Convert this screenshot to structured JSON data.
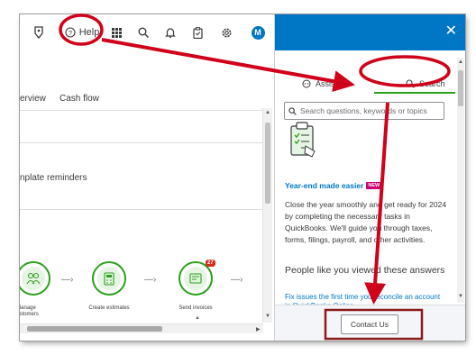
{
  "topbar": {
    "help_label": "Help",
    "avatar_initial": "M",
    "icons": [
      "tag-icon",
      "help-icon",
      "apps-grid-icon",
      "search-icon",
      "bell-icon",
      "clipboard-icon",
      "gear-icon"
    ]
  },
  "tabs": [
    {
      "label": "erview"
    },
    {
      "label": "Cash flow"
    }
  ],
  "reminders": {
    "text": "nplate reminders"
  },
  "flow": {
    "steps": [
      {
        "label": "Manage customers",
        "icon": "customers-icon"
      },
      {
        "label": "Create estimates",
        "icon": "calculator-icon"
      },
      {
        "label": "Send invoices",
        "icon": "invoice-icon",
        "badge": "27"
      }
    ]
  },
  "panel": {
    "tabs": [
      {
        "label": "Assistant",
        "icon": "assistant-icon"
      },
      {
        "label": "Search",
        "icon": "search-icon",
        "selected": true
      }
    ],
    "search_placeholder": "Search questions, keywords or topics",
    "promo": {
      "title": "Year-end made easier",
      "badge": "NEW",
      "body": "Close the year smoothly and get ready for 2024 by completing the necessary tasks in QuickBooks. We'll guide you through taxes, forms, filings, payroll, and other activities."
    },
    "people_heading": "People like you viewed these answers",
    "answer_link": "Fix issues the first time you reconcile an account in QuickBooks Online",
    "contact_label": "Contact Us"
  },
  "annotation_colors": {
    "highlight": "#d0021b",
    "box": "#8b1a1a"
  }
}
